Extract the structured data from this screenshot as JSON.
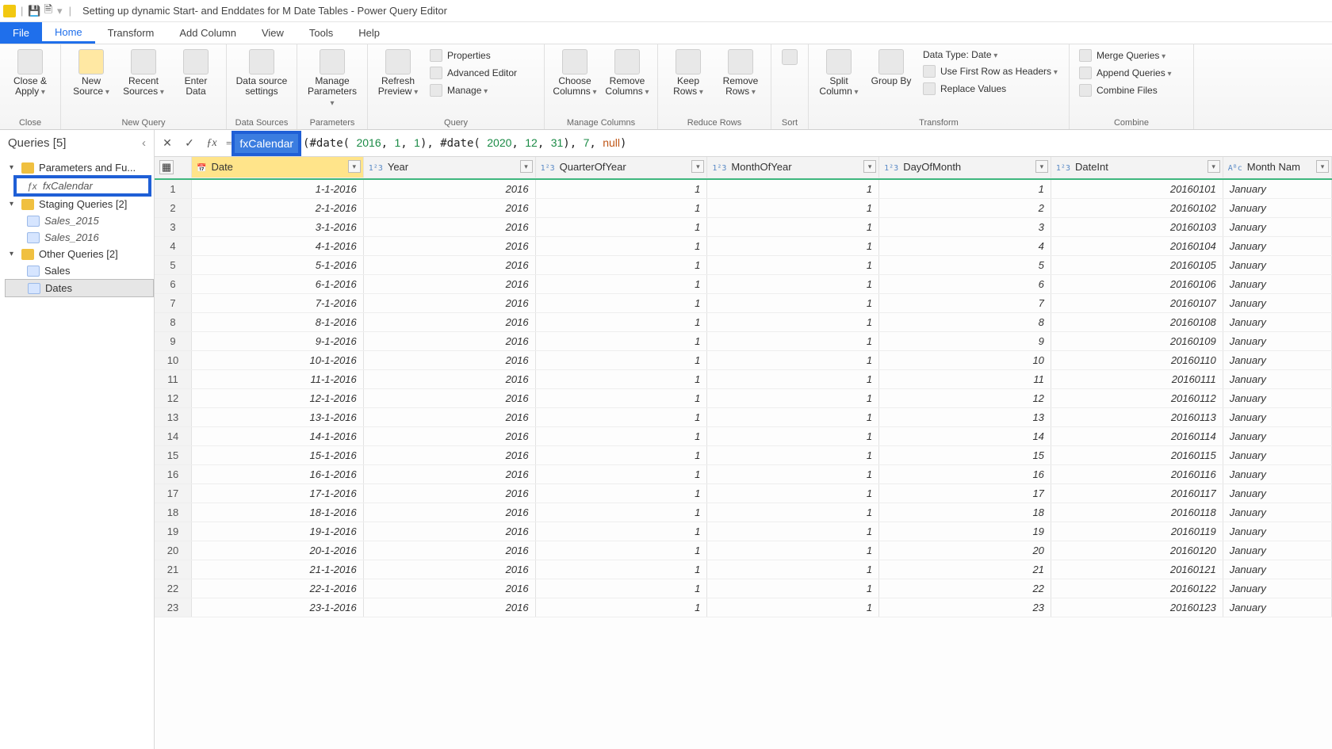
{
  "window": {
    "title": "Setting up dynamic Start- and Enddates for M Date Tables - Power Query Editor"
  },
  "tabs": {
    "file": "File",
    "home": "Home",
    "transform": "Transform",
    "add": "Add Column",
    "view": "View",
    "tools": "Tools",
    "help": "Help"
  },
  "ribbon": {
    "close": {
      "apply": "Close &\nApply",
      "group": "Close"
    },
    "newq": {
      "newSource": "New\nSource",
      "recent": "Recent\nSources",
      "enter": "Enter\nData",
      "group": "New Query"
    },
    "ds": {
      "settings": "Data source\nsettings",
      "group": "Data Sources"
    },
    "param": {
      "manage": "Manage\nParameters",
      "group": "Parameters"
    },
    "query": {
      "refresh": "Refresh\nPreview",
      "props": "Properties",
      "adv": "Advanced Editor",
      "manage": "Manage",
      "group": "Query"
    },
    "cols": {
      "choose": "Choose\nColumns",
      "remove": "Remove\nColumns",
      "group": "Manage Columns"
    },
    "rows": {
      "keep": "Keep\nRows",
      "remove": "Remove\nRows",
      "group": "Reduce Rows"
    },
    "sort": {
      "group": "Sort"
    },
    "trans": {
      "split": "Split\nColumn",
      "groupby": "Group\nBy",
      "dtype": "Data Type: Date",
      "firstrow": "Use First Row as Headers",
      "replace": "Replace Values",
      "group": "Transform"
    },
    "comb": {
      "merge": "Merge Queries",
      "append": "Append Queries",
      "combine": "Combine Files",
      "group": "Combine"
    }
  },
  "queries": {
    "header": "Queries [5]",
    "groups": {
      "params": "Parameters and Fu...",
      "fx": "fxCalendar",
      "staging": "Staging Queries [2]",
      "s2015": "Sales_2015",
      "s2016": "Sales_2016",
      "other": "Other Queries [2]",
      "sales": "Sales",
      "dates": "Dates"
    }
  },
  "formula": {
    "fn": "fxCalendar",
    "rest_pre": "(#date( ",
    "d1y": "2016",
    "d1m": "1",
    "d1d": "1",
    "d2y": "2020",
    "d2m": "12",
    "d2d": "31",
    "arg3": "7",
    "arg4": "null"
  },
  "columns": [
    "Date",
    "Year",
    "QuarterOfYear",
    "MonthOfYear",
    "DayOfMonth",
    "DateInt",
    "Month Nam"
  ],
  "coltypes": [
    "date",
    "num",
    "num",
    "num",
    "num",
    "num",
    "text"
  ],
  "rows": [
    {
      "n": 1,
      "date": "1-1-2016",
      "year": 2016,
      "q": 1,
      "m": 1,
      "d": 1,
      "di": 20160101,
      "mn": "January"
    },
    {
      "n": 2,
      "date": "2-1-2016",
      "year": 2016,
      "q": 1,
      "m": 1,
      "d": 2,
      "di": 20160102,
      "mn": "January"
    },
    {
      "n": 3,
      "date": "3-1-2016",
      "year": 2016,
      "q": 1,
      "m": 1,
      "d": 3,
      "di": 20160103,
      "mn": "January"
    },
    {
      "n": 4,
      "date": "4-1-2016",
      "year": 2016,
      "q": 1,
      "m": 1,
      "d": 4,
      "di": 20160104,
      "mn": "January"
    },
    {
      "n": 5,
      "date": "5-1-2016",
      "year": 2016,
      "q": 1,
      "m": 1,
      "d": 5,
      "di": 20160105,
      "mn": "January"
    },
    {
      "n": 6,
      "date": "6-1-2016",
      "year": 2016,
      "q": 1,
      "m": 1,
      "d": 6,
      "di": 20160106,
      "mn": "January"
    },
    {
      "n": 7,
      "date": "7-1-2016",
      "year": 2016,
      "q": 1,
      "m": 1,
      "d": 7,
      "di": 20160107,
      "mn": "January"
    },
    {
      "n": 8,
      "date": "8-1-2016",
      "year": 2016,
      "q": 1,
      "m": 1,
      "d": 8,
      "di": 20160108,
      "mn": "January"
    },
    {
      "n": 9,
      "date": "9-1-2016",
      "year": 2016,
      "q": 1,
      "m": 1,
      "d": 9,
      "di": 20160109,
      "mn": "January"
    },
    {
      "n": 10,
      "date": "10-1-2016",
      "year": 2016,
      "q": 1,
      "m": 1,
      "d": 10,
      "di": 20160110,
      "mn": "January"
    },
    {
      "n": 11,
      "date": "11-1-2016",
      "year": 2016,
      "q": 1,
      "m": 1,
      "d": 11,
      "di": 20160111,
      "mn": "January"
    },
    {
      "n": 12,
      "date": "12-1-2016",
      "year": 2016,
      "q": 1,
      "m": 1,
      "d": 12,
      "di": 20160112,
      "mn": "January"
    },
    {
      "n": 13,
      "date": "13-1-2016",
      "year": 2016,
      "q": 1,
      "m": 1,
      "d": 13,
      "di": 20160113,
      "mn": "January"
    },
    {
      "n": 14,
      "date": "14-1-2016",
      "year": 2016,
      "q": 1,
      "m": 1,
      "d": 14,
      "di": 20160114,
      "mn": "January"
    },
    {
      "n": 15,
      "date": "15-1-2016",
      "year": 2016,
      "q": 1,
      "m": 1,
      "d": 15,
      "di": 20160115,
      "mn": "January"
    },
    {
      "n": 16,
      "date": "16-1-2016",
      "year": 2016,
      "q": 1,
      "m": 1,
      "d": 16,
      "di": 20160116,
      "mn": "January"
    },
    {
      "n": 17,
      "date": "17-1-2016",
      "year": 2016,
      "q": 1,
      "m": 1,
      "d": 17,
      "di": 20160117,
      "mn": "January"
    },
    {
      "n": 18,
      "date": "18-1-2016",
      "year": 2016,
      "q": 1,
      "m": 1,
      "d": 18,
      "di": 20160118,
      "mn": "January"
    },
    {
      "n": 19,
      "date": "19-1-2016",
      "year": 2016,
      "q": 1,
      "m": 1,
      "d": 19,
      "di": 20160119,
      "mn": "January"
    },
    {
      "n": 20,
      "date": "20-1-2016",
      "year": 2016,
      "q": 1,
      "m": 1,
      "d": 20,
      "di": 20160120,
      "mn": "January"
    },
    {
      "n": 21,
      "date": "21-1-2016",
      "year": 2016,
      "q": 1,
      "m": 1,
      "d": 21,
      "di": 20160121,
      "mn": "January"
    },
    {
      "n": 22,
      "date": "22-1-2016",
      "year": 2016,
      "q": 1,
      "m": 1,
      "d": 22,
      "di": 20160122,
      "mn": "January"
    },
    {
      "n": 23,
      "date": "23-1-2016",
      "year": 2016,
      "q": 1,
      "m": 1,
      "d": 23,
      "di": 20160123,
      "mn": "January"
    }
  ]
}
